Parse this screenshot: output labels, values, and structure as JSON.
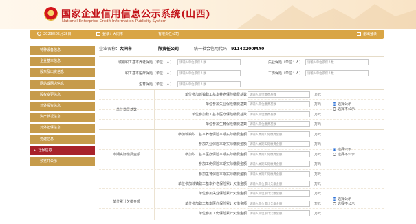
{
  "header": {
    "title_cn": "国家企业信用信息公示系统(山西)",
    "title_en": "National Enterprise Credit Information Publicity System"
  },
  "topbar": {
    "date": "2023年05月28日",
    "user": "登录：大同市",
    "company": "有限责任公司",
    "logout": "退出登录"
  },
  "sidebar": {
    "items": [
      {
        "label": "特种设备信息"
      },
      {
        "label": "企业基本信息"
      },
      {
        "label": "股东及出资信息"
      },
      {
        "label": "网站或网店信息"
      },
      {
        "label": "股权变更信息"
      },
      {
        "label": "对外投资信息"
      },
      {
        "label": "资产状况信息"
      },
      {
        "label": "对外担保信息"
      },
      {
        "label": "党建信息"
      },
      {
        "label": "社保信息"
      },
      {
        "label": "预览并公示"
      }
    ]
  },
  "company": {
    "name_label": "企业名称：",
    "name_value": "大同市",
    "name_suffix": "限责任公司",
    "credit_label": "统一社会信用代码：",
    "credit_value": "91140200MA0"
  },
  "insurance": {
    "rows": [
      {
        "label": "城镇职工基本养老保险（单位：人）",
        "placeholder": "请输入单位参保人数"
      },
      {
        "label": "失业保险（单位：人）",
        "placeholder": "请输入单位参保人数"
      },
      {
        "label": "职工基本医疗保险（单位：人）",
        "placeholder": "请输入单位参保人数"
      },
      {
        "label": "工伤保险（单位：人）",
        "placeholder": "请输入单位参保人数"
      },
      {
        "label": "生育保险（单位：人）",
        "placeholder": "请输入单位参保人数"
      }
    ]
  },
  "groups": [
    {
      "title": "单位缴费基数",
      "rows": [
        {
          "label": "单位参加城镇职工基本养老保险缴费基数",
          "placeholder": "请输入单位缴费基数"
        },
        {
          "label": "单位参加失业保险缴费基数",
          "placeholder": "请输入单位缴费基数"
        },
        {
          "label": "单位参加职工基本医疗保险缴费基数",
          "placeholder": "请输入单位缴费基数"
        },
        {
          "label": "单位参加生育保险缴费基数",
          "placeholder": "请输入单位缴费基数"
        }
      ],
      "unit": "万元",
      "radio_public": "选择公示",
      "radio_private": "选择不公示"
    },
    {
      "title": "本期实际缴费金额",
      "rows": [
        {
          "label": "参加城镇职工基本养老保险本期实际缴费金额",
          "placeholder": "请输入本期实际缴费金额"
        },
        {
          "label": "参加失业保险本期实际缴费金额",
          "placeholder": "请输入本期实际缴费金额"
        },
        {
          "label": "参加职工基本医疗保险本期实际缴费金额",
          "placeholder": "请输入本期实际缴费金额"
        },
        {
          "label": "参加工伤保险本期实际缴费金额",
          "placeholder": "请输入本期实际缴费金额"
        },
        {
          "label": "参加生育保险本期实际缴费金额",
          "placeholder": "请输入本期实际缴费金额"
        }
      ],
      "unit": "万元",
      "radio_public": "选择公示",
      "radio_private": "选择不公示"
    },
    {
      "title": "单位累计欠缴金额",
      "rows": [
        {
          "label": "单位参加城镇职工基本养老保险累计欠缴金额",
          "placeholder": "请输入单位累计欠缴金额"
        },
        {
          "label": "单位参加失业保险累计欠缴金额",
          "placeholder": "请输入单位累计欠缴金额"
        },
        {
          "label": "单位参加职工基本医疗保险累计欠缴金额",
          "placeholder": "请输入单位累计欠缴金额"
        },
        {
          "label": "单位参加工伤保险累计欠缴金额",
          "placeholder": "请输入单位累计欠缴金额"
        }
      ],
      "unit": "万元",
      "radio_public": "选择公示",
      "radio_private": "选择不公示"
    }
  ],
  "colors": {
    "brand_red": "#c3141a",
    "gold": "#d9a545",
    "sidebar": "#c69b4b",
    "sidebar_active": "#a8222a"
  }
}
